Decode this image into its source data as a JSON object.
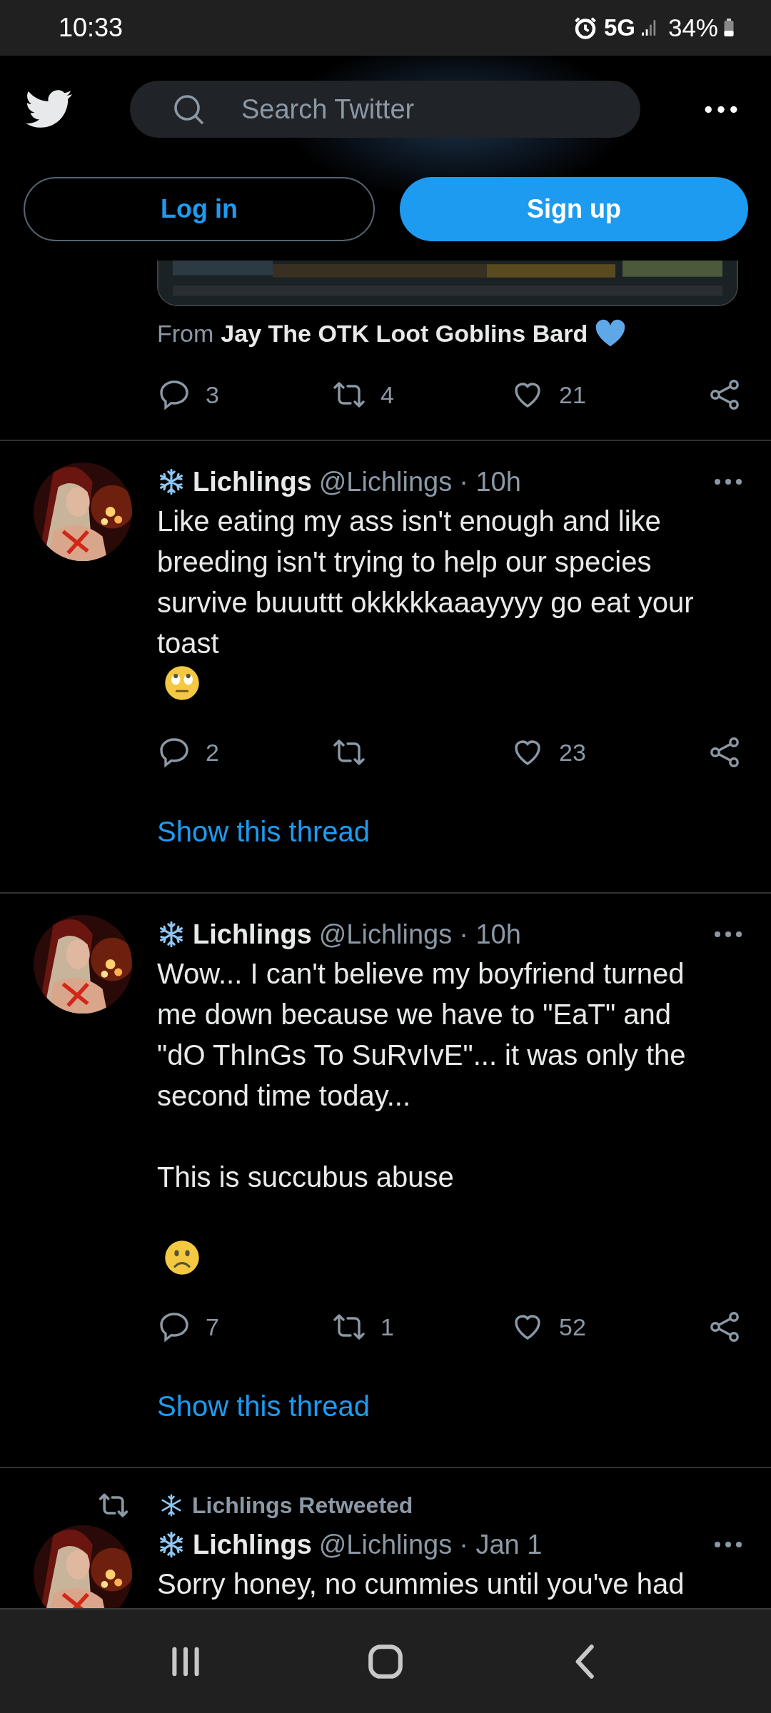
{
  "status_bar": {
    "time": "10:33",
    "network": "5G",
    "battery": "34%"
  },
  "header": {
    "search": {
      "placeholder": "Search Twitter"
    },
    "buttons": [
      {
        "label": "Log in",
        "kind": "outline"
      },
      {
        "label": "Sign up",
        "kind": "filled"
      }
    ]
  },
  "tweets": [
    {
      "kind": "partial",
      "from_prefix": "From",
      "from_name": "Jay The OTK Loot Goblins Bard",
      "replies": "3",
      "retweets": "4",
      "likes": "21"
    },
    {
      "kind": "full",
      "name": "Lichlings",
      "handle": "@Lichlings",
      "time": "· 10h",
      "paragraphs": [
        {
          "text": "Like eating my ass isn't enough and like breeding isn't trying to help our species survive buuuttt okkkkkaaayyyy go eat your toast",
          "kind": "text_eyeroll"
        }
      ],
      "replies": "2",
      "likes": "23",
      "show_thread": "Show this thread"
    },
    {
      "kind": "full",
      "name": "Lichlings",
      "handle": "@Lichlings",
      "time": "· 10h",
      "paragraphs": [
        {
          "kind": "text",
          "text": "Wow... I can't believe my boyfriend turned me down because we have to \"EaT\" and \"dO ThInGs To SuRvIvE\"... it was only the second time today..."
        },
        {
          "kind": "text",
          "text": "This is succubus abuse"
        },
        {
          "kind": "frown"
        }
      ],
      "replies": "7",
      "retweets": "1",
      "likes": "52",
      "show_thread": "Show this thread"
    },
    {
      "kind": "retweet",
      "retweeted_by": "Lichlings Retweeted",
      "name": "Lichlings",
      "handle": "@Lichlings",
      "time": "· Jan 1",
      "paragraphs": [
        {
          "kind": "text",
          "text": "Sorry honey, no cummies until you've had"
        }
      ]
    }
  ]
}
